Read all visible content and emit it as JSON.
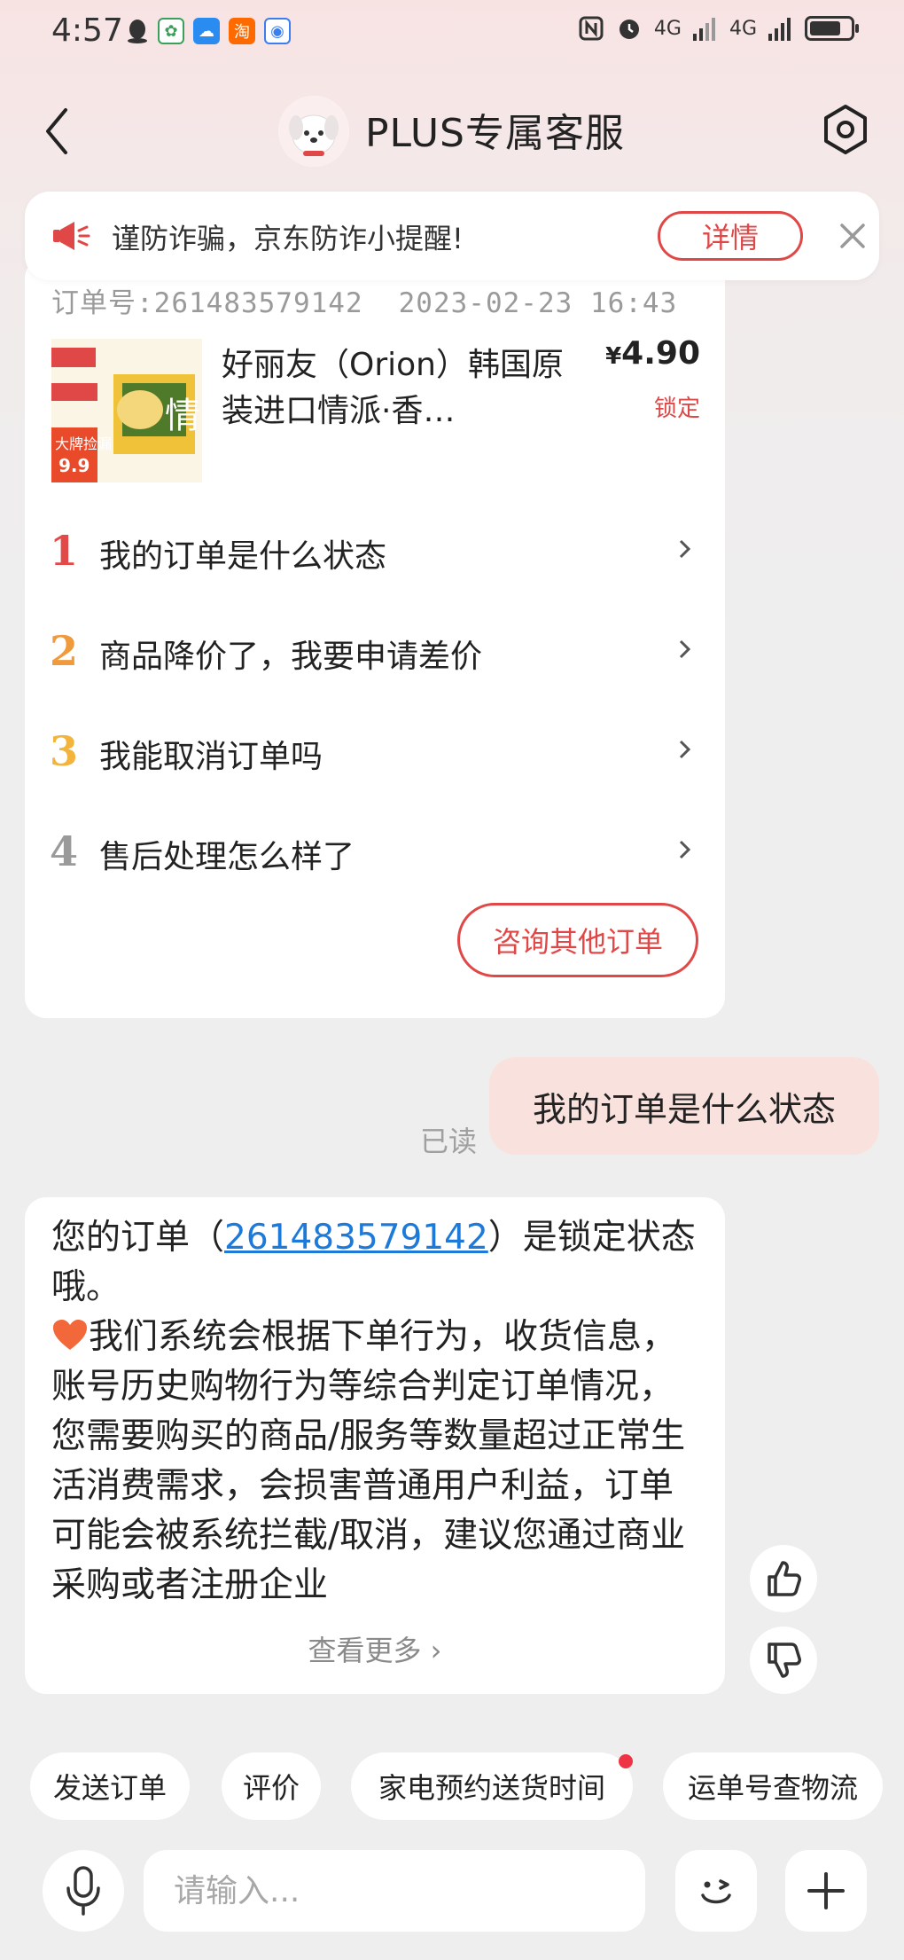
{
  "status_bar": {
    "time": "4:57",
    "network_1": "4G",
    "network_2": "4G"
  },
  "header": {
    "title": "PLUS专属客服"
  },
  "notice": {
    "text": "谨防诈骗，京东防诈小提醒!",
    "detail_label": "详情"
  },
  "order": {
    "order_no": "订单号:261483579142",
    "datetime": "2023-02-23 16:43",
    "product_name": "好丽友（Orion）韩国原装进口情派·香…",
    "price_symbol": "¥",
    "price": "4.90",
    "status": "锁定",
    "product_badge": "大牌捡漏",
    "product_badge_price": "9.9",
    "product_brand_char": "情"
  },
  "faq": [
    {
      "num": "1",
      "text": "我的订单是什么状态",
      "color": "#e24a4a"
    },
    {
      "num": "2",
      "text": "商品降价了，我要申请差价",
      "color": "#f09a3e"
    },
    {
      "num": "3",
      "text": "我能取消订单吗",
      "color": "#f2b43c"
    },
    {
      "num": "4",
      "text": "售后处理怎么样了",
      "color": "#9a9a9a"
    }
  ],
  "consult_btn": "咨询其他订单",
  "user_message": "我的订单是什么状态",
  "read_label": "已读",
  "reply": {
    "prefix": "您的订单（",
    "order_link": "261483579142",
    "suffix": "）是锁定状态哦。",
    "body": "我们系统会根据下单行为，收货信息，账号历史购物行为等综合判定订单情况，您需要购买的商品/服务等数量超过正常生活消费需求，会损害普通用户利益，订单可能会被系统拦截/取消，建议您通过商业采购或者注册企业",
    "see_more": "查看更多 ›"
  },
  "chips": [
    "发送订单",
    "评价",
    "家电预约送货时间",
    "运单号查物流"
  ],
  "input": {
    "placeholder": "请输入..."
  },
  "colors": {
    "accent": "#e04848",
    "link": "#1e7ad8",
    "user_bubble": "#f9e2dd"
  }
}
